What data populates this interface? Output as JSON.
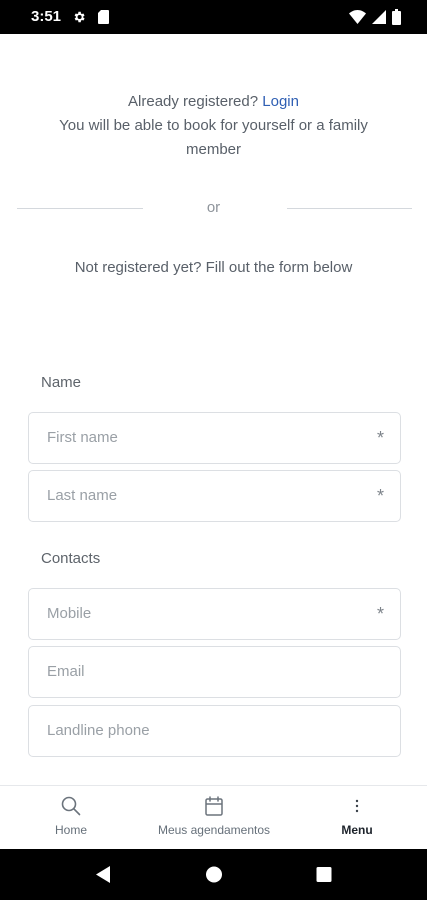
{
  "status_bar": {
    "time": "3:51",
    "icons": [
      "gear-icon",
      "sd-card-icon",
      "wifi-icon",
      "signal-icon",
      "battery-icon"
    ]
  },
  "intro": {
    "already_registered": "Already registered?",
    "login_link": "Login",
    "book_text": "You will be able to book for yourself or a family member"
  },
  "divider": {
    "text": "or"
  },
  "not_registered": "Not registered yet? Fill out the form below",
  "form": {
    "name_section": "Name",
    "first_name_placeholder": "First name",
    "last_name_placeholder": "Last name",
    "contacts_section": "Contacts",
    "mobile_placeholder": "Mobile",
    "email_placeholder": "Email",
    "landline_placeholder": "Landline phone",
    "required_mark": "*"
  },
  "bottom_nav": {
    "home": "Home",
    "appointments": "Meus agendamentos",
    "menu": "Menu",
    "active": "Menu"
  },
  "colors": {
    "link": "#2f5fb3",
    "text": "#596069",
    "border": "#dcdfe3"
  }
}
